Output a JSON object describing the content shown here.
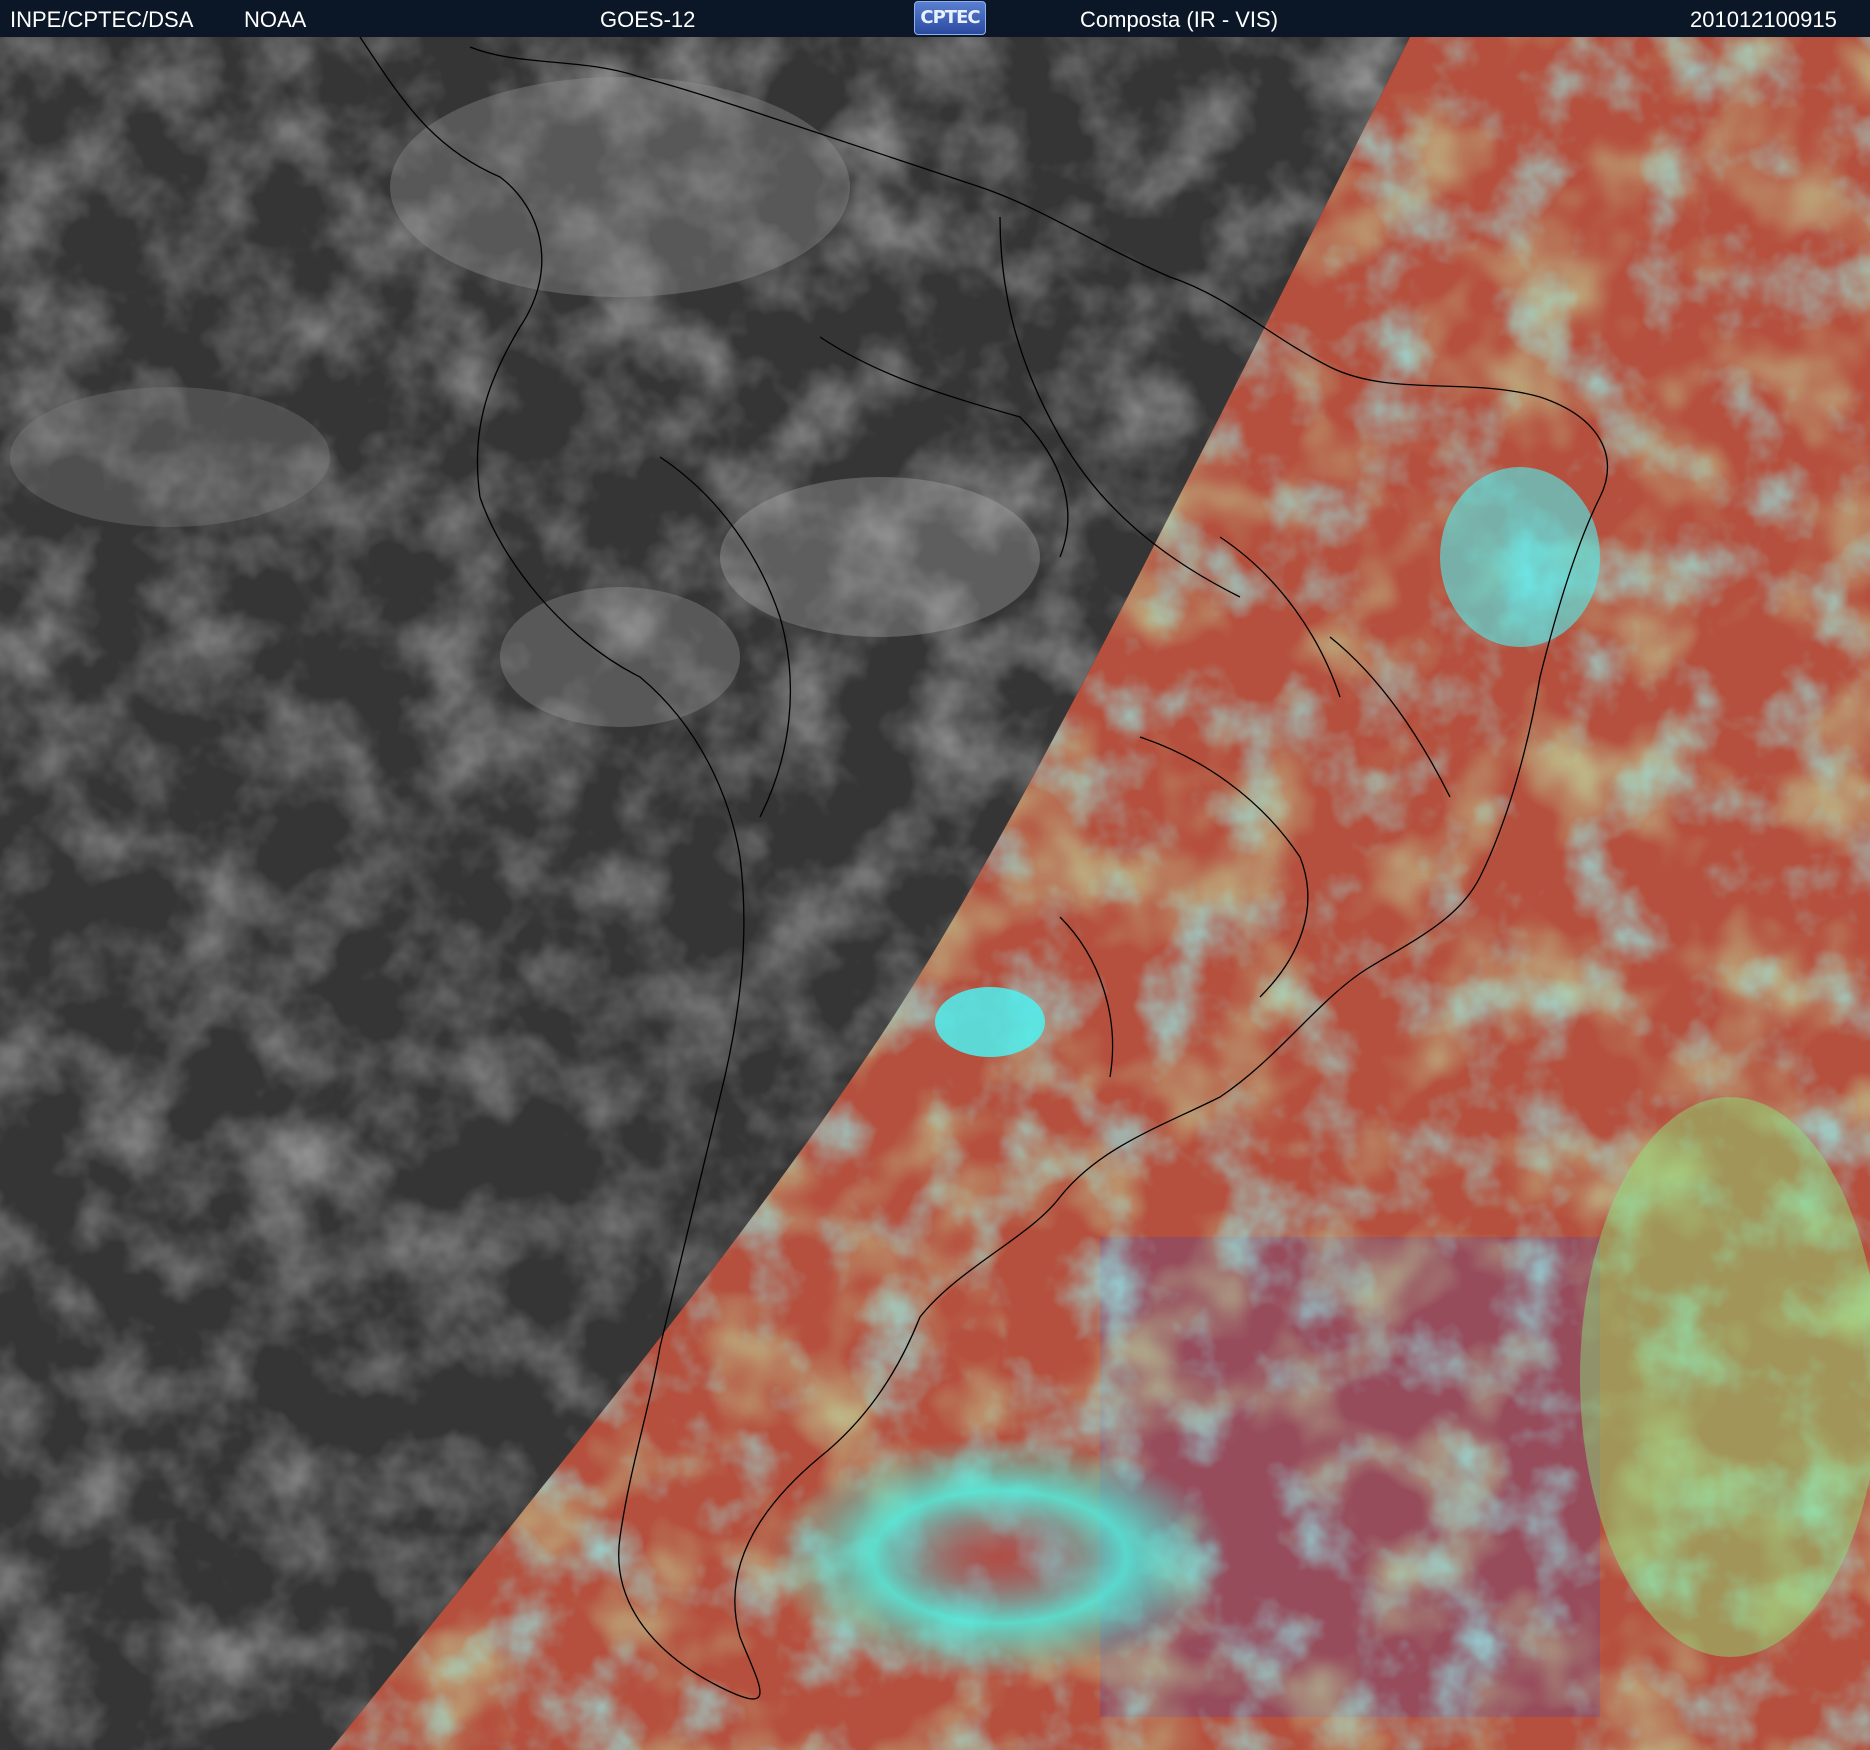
{
  "header": {
    "agency": "INPE/CPTEC/DSA",
    "partner": "NOAA",
    "satellite": "GOES-12",
    "logo_text": "CPTEC",
    "product": "Composta (IR - VIS)",
    "timestamp": "201012100915"
  },
  "colors": {
    "header_bg": "#0b1626",
    "night_side": "#3a3a3a",
    "day_ocean": "#b5503e",
    "cloud_cyan": "#4ff0f0",
    "cloud_green": "#8ae87a",
    "coastline": "#000000"
  }
}
